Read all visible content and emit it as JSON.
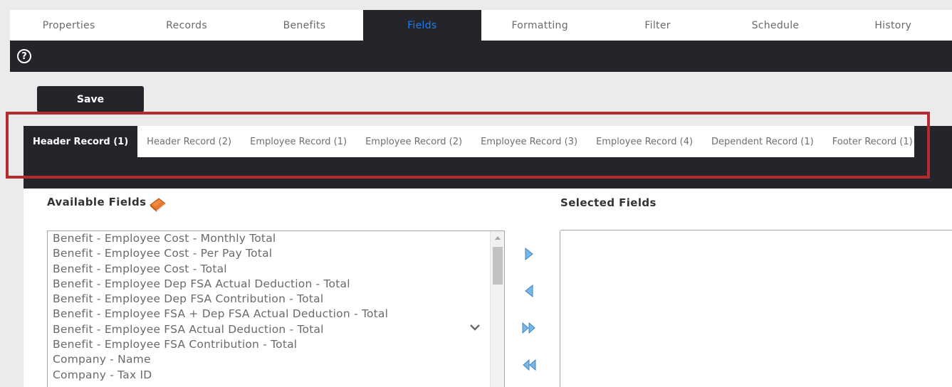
{
  "top_tabs": [
    {
      "label": "Properties"
    },
    {
      "label": "Records"
    },
    {
      "label": "Benefits"
    },
    {
      "label": "Fields",
      "active": true
    },
    {
      "label": "Formatting"
    },
    {
      "label": "Filter"
    },
    {
      "label": "Schedule"
    },
    {
      "label": "History"
    }
  ],
  "help_icon": "question-circle-icon",
  "save_label": "Save",
  "record_tabs": [
    {
      "label": "Header Record (1)",
      "active": true
    },
    {
      "label": "Header Record (2)"
    },
    {
      "label": "Employee Record (1)"
    },
    {
      "label": "Employee Record (2)"
    },
    {
      "label": "Employee Record (3)"
    },
    {
      "label": "Employee Record (4)"
    },
    {
      "label": "Dependent Record (1)"
    },
    {
      "label": "Footer Record (1)"
    }
  ],
  "available_fields": {
    "title": "Available Fields",
    "icon": "book-icon",
    "items": [
      "Benefit - Employee Cost - Monthly Total",
      "Benefit - Employee Cost - Per Pay Total",
      "Benefit - Employee Cost - Total",
      "Benefit - Employee Dep FSA Actual Deduction - Total",
      "Benefit - Employee Dep FSA Contribution - Total",
      "Benefit - Employee FSA + Dep FSA Actual Deduction - Total",
      "Benefit - Employee FSA Actual Deduction - Total",
      "Benefit - Employee FSA Contribution - Total",
      "Company - Name",
      "Company - Tax ID"
    ]
  },
  "selected_fields": {
    "title": "Selected Fields",
    "items": []
  },
  "transfer_buttons": [
    {
      "name": "add-field-button",
      "icon": "arrow-right-icon"
    },
    {
      "name": "remove-field-button",
      "icon": "arrow-left-icon"
    },
    {
      "name": "add-all-fields-button",
      "icon": "double-arrow-right-icon"
    },
    {
      "name": "remove-all-fields-button",
      "icon": "double-arrow-left-icon"
    }
  ],
  "colors": {
    "dark": "#23252b",
    "active_tab_text": "#1a7ef2",
    "highlight": "#b52c30",
    "arrow": "#5ba3dc"
  }
}
